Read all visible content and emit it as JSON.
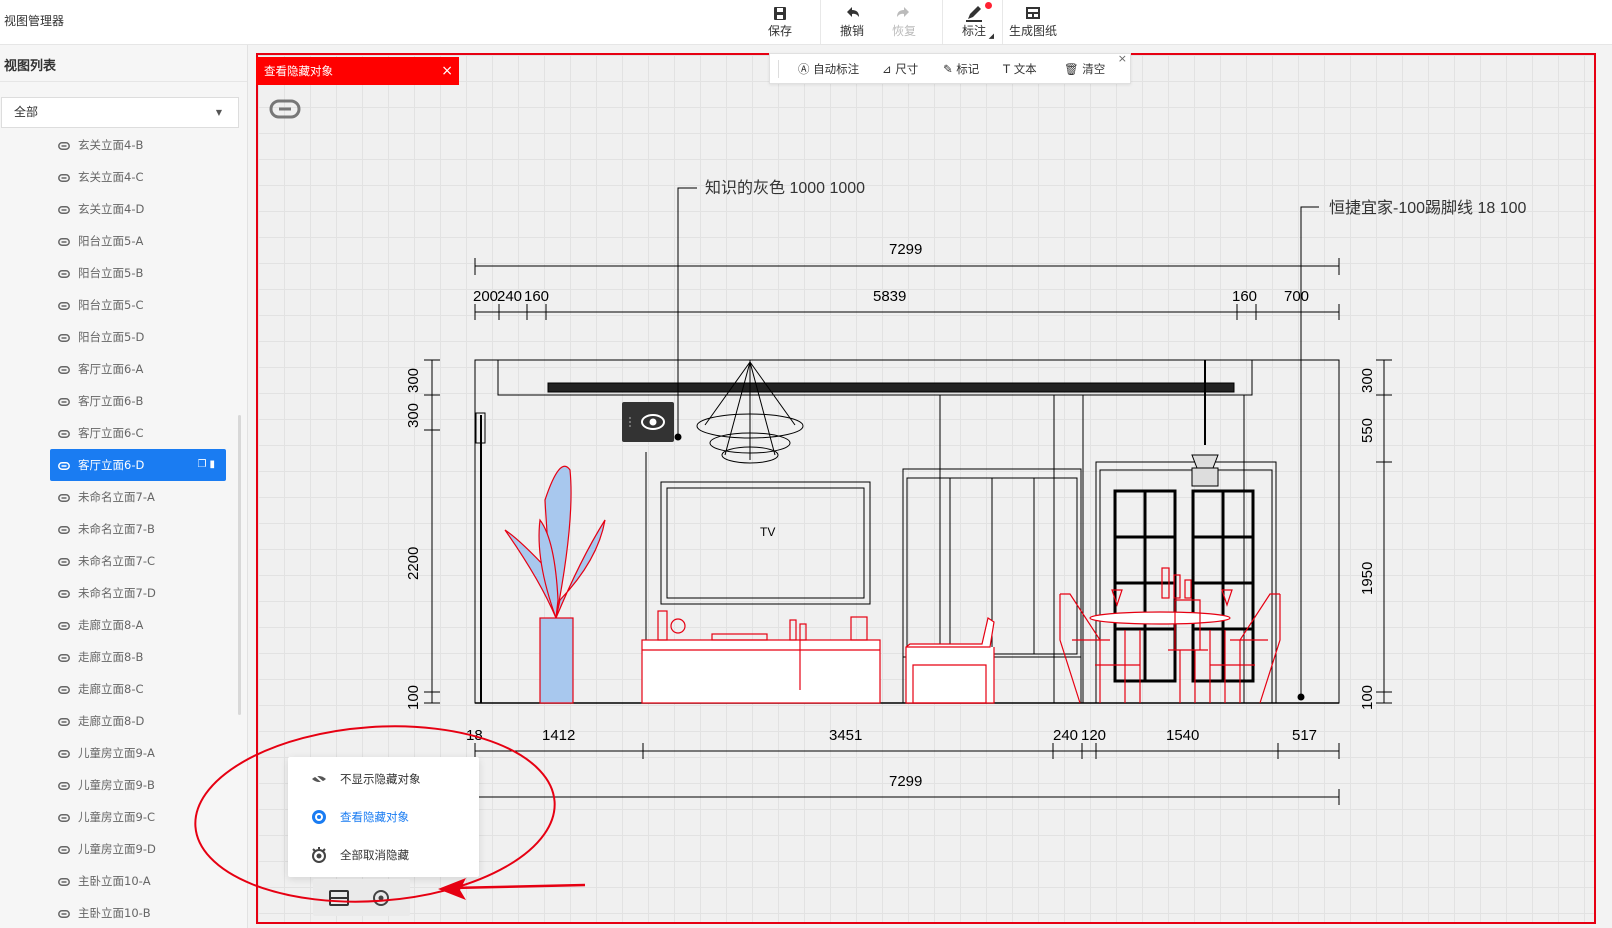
{
  "app": {
    "title": "视图管理器"
  },
  "toolbar": {
    "save": "保存",
    "undo": "撤销",
    "redo": "恢复",
    "annotate": "标注",
    "generate": "生成图纸"
  },
  "sidebar": {
    "title": "视图列表",
    "filter_value": "全部",
    "items": [
      {
        "label": "玄关立面4-B"
      },
      {
        "label": "玄关立面4-C"
      },
      {
        "label": "玄关立面4-D"
      },
      {
        "label": "阳台立面5-A"
      },
      {
        "label": "阳台立面5-B"
      },
      {
        "label": "阳台立面5-C"
      },
      {
        "label": "阳台立面5-D"
      },
      {
        "label": "客厅立面6-A"
      },
      {
        "label": "客厅立面6-B"
      },
      {
        "label": "客厅立面6-C"
      },
      {
        "label": "客厅立面6-D",
        "active": true
      },
      {
        "label": "未命名立面7-A"
      },
      {
        "label": "未命名立面7-B"
      },
      {
        "label": "未命名立面7-C"
      },
      {
        "label": "未命名立面7-D"
      },
      {
        "label": "走廊立面8-A"
      },
      {
        "label": "走廊立面8-B"
      },
      {
        "label": "走廊立面8-C"
      },
      {
        "label": "走廊立面8-D"
      },
      {
        "label": "儿童房立面9-A"
      },
      {
        "label": "儿童房立面9-B"
      },
      {
        "label": "儿童房立面9-C"
      },
      {
        "label": "儿童房立面9-D"
      },
      {
        "label": "主卧立面10-A"
      },
      {
        "label": "主卧立面10-B"
      }
    ]
  },
  "hidden_tab": {
    "label": "查看隐藏对象",
    "close": "×"
  },
  "anno_bar": {
    "auto": "自动标注",
    "dimension": "尺寸",
    "mark": "标记",
    "text": "文本",
    "clear": "清空",
    "close": "×"
  },
  "drawing": {
    "callout_left": "知识的灰色 1000 1000",
    "callout_right": "恒捷宜家-100踢脚线 18 100",
    "tv_label": "TV",
    "dim_top_total": "7299",
    "dim_top_segments": [
      "200",
      "240",
      "160",
      "5839",
      "160",
      "700"
    ],
    "dim_bottom_segments": [
      "18",
      "1412",
      "3451",
      "240",
      "120",
      "1540",
      "517"
    ],
    "dim_bottom_total": "7299",
    "dim_left": [
      "300",
      "300",
      "2200",
      "100"
    ],
    "dim_right": [
      "300",
      "550",
      "1950",
      "100"
    ]
  },
  "context_menu": {
    "items": [
      {
        "label": "不显示隐藏对象",
        "icon": "eye-off-icon"
      },
      {
        "label": "查看隐藏对象",
        "icon": "eye-icon",
        "active": true
      },
      {
        "label": "全部取消隐藏",
        "icon": "eye-all-icon"
      }
    ]
  },
  "colors": {
    "accent": "#1a7cf2",
    "highlight": "#e60012",
    "furniture": "#e60012",
    "plant": "#a8c8ee"
  }
}
